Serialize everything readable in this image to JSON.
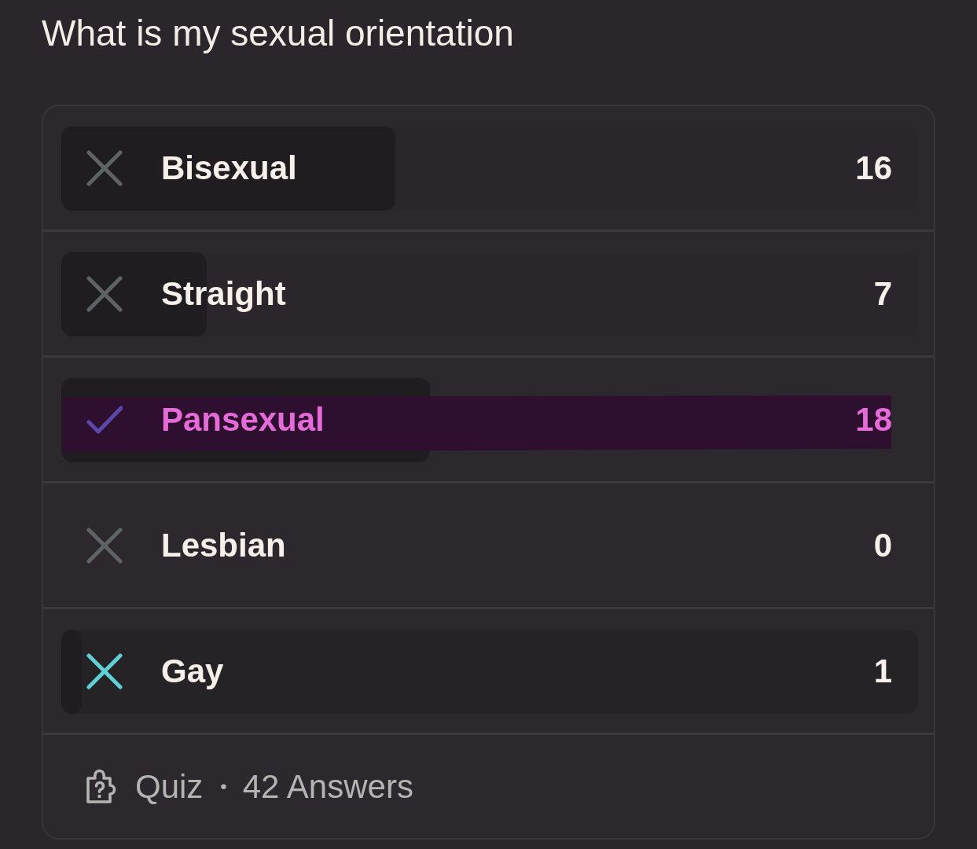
{
  "title": "What is my sexual orientation",
  "options": [
    {
      "label": "Bisexual",
      "count": "16",
      "level": 0.39,
      "correct": false,
      "selected": false
    },
    {
      "label": "Straight",
      "count": "7",
      "level": 0.17,
      "correct": false,
      "selected": false
    },
    {
      "label": "Pansexual",
      "count": "18",
      "level": 0.43,
      "correct": true,
      "selected": false
    },
    {
      "label": "Lesbian",
      "count": "0",
      "correct": false,
      "selected": false
    },
    {
      "label": "Gay",
      "count": "1",
      "level": 0.024,
      "correct": false,
      "selected": true
    }
  ],
  "footer": {
    "type": "Quiz",
    "separator": "•",
    "answers": "42 Answers"
  }
}
